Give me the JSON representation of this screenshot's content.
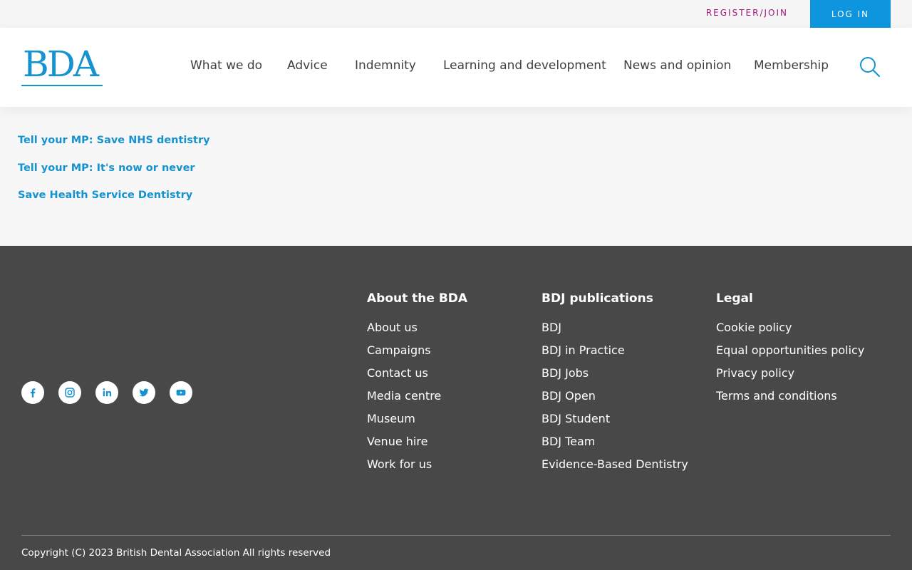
{
  "utility": {
    "register_label": "REGISTER/JOIN",
    "login_label": "LOG IN"
  },
  "header": {
    "logo_text": "BDA",
    "nav": [
      {
        "label": "What we do"
      },
      {
        "label": "Advice"
      },
      {
        "label": "Indemnity"
      },
      {
        "label": "Learning and development"
      },
      {
        "label": "News and opinion"
      },
      {
        "label": "Membership"
      }
    ],
    "search_icon": "search-icon"
  },
  "campaigns": {
    "links": [
      {
        "label": "Tell your MP: Save NHS dentistry"
      },
      {
        "label": "Tell your MP: It's now or never"
      },
      {
        "label": "Save Health Service Dentistry"
      }
    ]
  },
  "footer": {
    "social": [
      {
        "icon": "facebook-icon"
      },
      {
        "icon": "instagram-icon"
      },
      {
        "icon": "linkedin-icon"
      },
      {
        "icon": "twitter-icon"
      },
      {
        "icon": "youtube-icon"
      }
    ],
    "columns": [
      {
        "title": "About the BDA",
        "links": [
          "About us",
          "Campaigns",
          "Contact us",
          "Media centre",
          "Museum",
          "Venue hire",
          "Work for us"
        ]
      },
      {
        "title": "BDJ publications",
        "links": [
          "BDJ",
          "BDJ in Practice",
          "BDJ Jobs",
          "BDJ Open",
          "BDJ Student",
          "BDJ Team",
          "Evidence-Based Dentistry"
        ]
      },
      {
        "title": "Legal",
        "links": [
          "Cookie policy",
          "Equal opportunities policy",
          "Privacy policy",
          "Terms and conditions"
        ]
      }
    ],
    "copyright": "Copyright (C) 2023 British Dental Association All rights reserved"
  },
  "colors": {
    "brand_blue": "#1592cf",
    "login_blue": "#0d96de",
    "register_magenta": "#a4177a",
    "footer_bg": "#484848",
    "page_bg": "#f7f7f7"
  }
}
